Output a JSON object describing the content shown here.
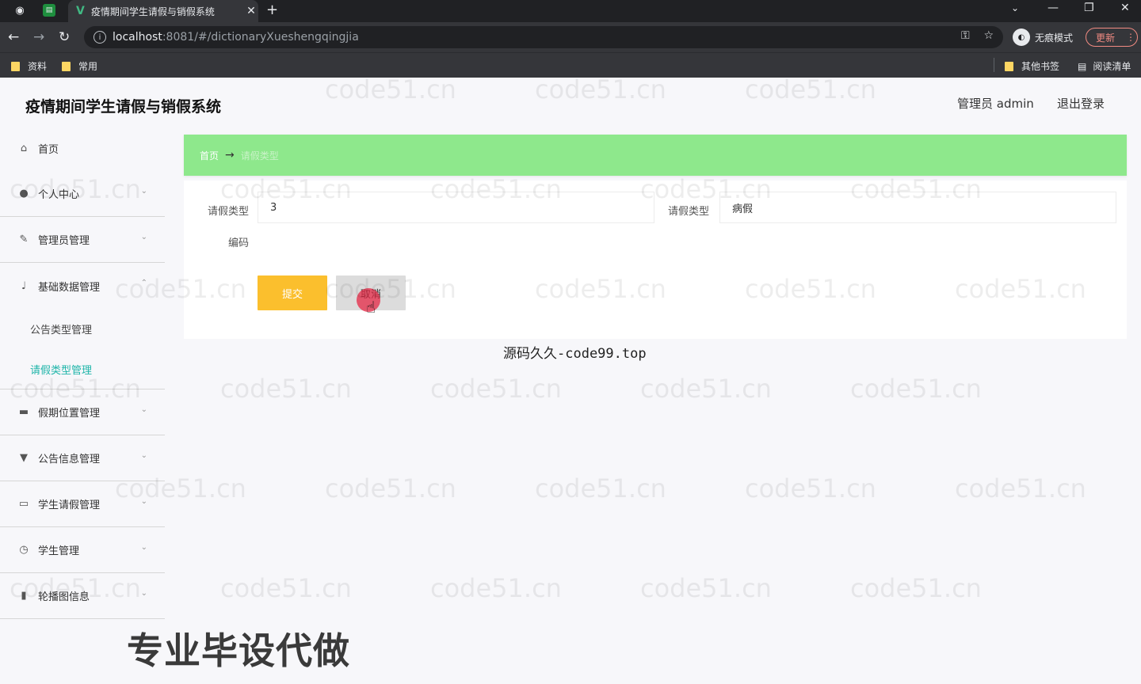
{
  "browser": {
    "tab_title": "疫情期间学生请假与销假系统",
    "url_host": "localhost",
    "url_path": ":8081/#/dictionaryXueshengqingjia",
    "incognito_label": "无痕模式",
    "update_label": "更新",
    "bookmarks": [
      "资料",
      "常用"
    ],
    "bookmarks_right": [
      "其他书签",
      "阅读清单"
    ]
  },
  "header": {
    "title": "疫情期间学生请假与销假系统",
    "user_label": "管理员 admin",
    "logout_label": "退出登录"
  },
  "sidebar": {
    "items": [
      {
        "label": "首页",
        "icon": "home-icon"
      },
      {
        "label": "个人中心",
        "icon": "user-icon"
      },
      {
        "label": "管理员管理",
        "icon": "edit-icon"
      },
      {
        "label": "基础数据管理",
        "icon": "mic-icon"
      },
      {
        "label": "公告类型管理"
      },
      {
        "label": "请假类型管理",
        "active": true
      },
      {
        "label": "假期位置管理",
        "icon": "chat-icon"
      },
      {
        "label": "公告信息管理",
        "icon": "pin-icon"
      },
      {
        "label": "学生请假管理",
        "icon": "message-icon"
      },
      {
        "label": "学生管理",
        "icon": "clock-icon"
      },
      {
        "label": "轮播图信息",
        "icon": "chart-icon"
      }
    ]
  },
  "breadcrumb": {
    "home": "首页",
    "current": "请假类型"
  },
  "form": {
    "field1_label": "请假类型",
    "field1_value": "3",
    "field2_label": "请假类型",
    "field2_value": "病假",
    "field3_label": "编码",
    "submit_label": "提交",
    "cancel_label": "取消"
  },
  "overlay": {
    "caption": "源码久久-code99.top",
    "promo": "专业毕设代做",
    "watermark": "code51.cn"
  },
  "colors": {
    "breadcrumb_bg": "#8ee88c",
    "submit_bg": "#fbbf2d",
    "active_menu": "#1fb5a9"
  }
}
